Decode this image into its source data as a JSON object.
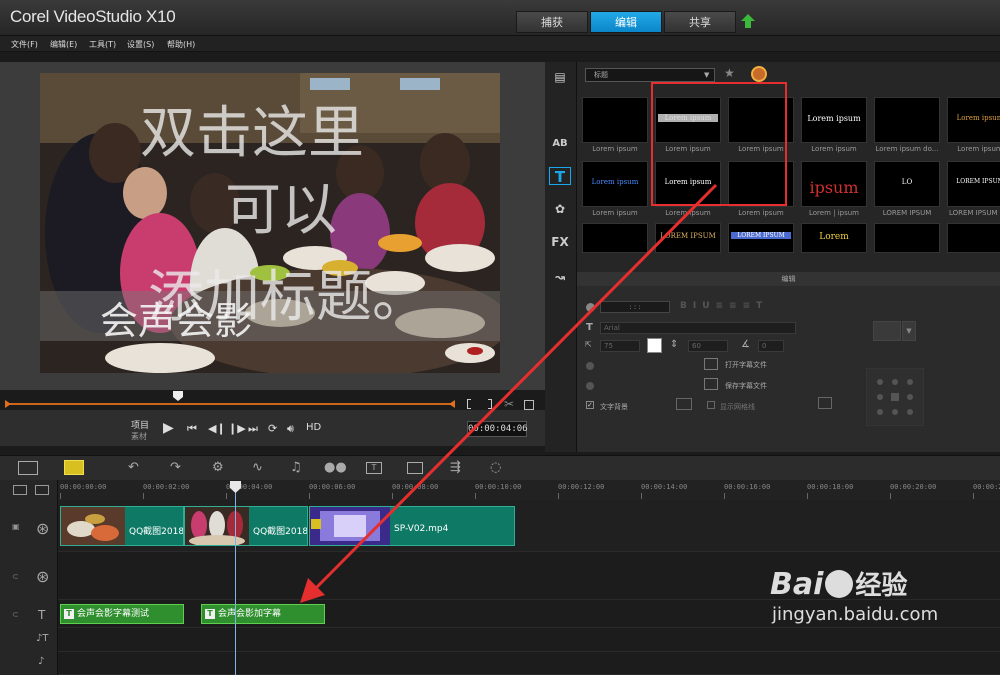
{
  "app": {
    "title": "Corel VideoStudio X10"
  },
  "tabs": [
    {
      "label": "捕获"
    },
    {
      "label": "编辑"
    },
    {
      "label": "共享"
    }
  ],
  "menu": [
    {
      "label": "文件(F)"
    },
    {
      "label": "编辑(E)"
    },
    {
      "label": "工具(T)"
    },
    {
      "label": "设置(S)"
    },
    {
      "label": "帮助(H)"
    }
  ],
  "preview": {
    "overlay_line1": "双击这里",
    "overlay_line2": "可以",
    "overlay_line3": "添加标题。",
    "subtitle_text": "会声会影",
    "project_label": "项目",
    "clip_label": "素材",
    "hd_label": "HD",
    "timecode": "00:00:04:06"
  },
  "library": {
    "dropdown": "标题",
    "thumbnails": [
      {
        "label": "Lorem ipsum",
        "text": ""
      },
      {
        "label": "Lorem ipsum",
        "text": "Lorem ipsum"
      },
      {
        "label": "Lorem ipsum",
        "text": ""
      },
      {
        "label": "Lorem ipsum",
        "text": "Lorem ipsum"
      },
      {
        "label": "Lorem ipsum do...",
        "text": ""
      },
      {
        "label": "Lorem ipsum",
        "text": "Lorem ipsum"
      },
      {
        "label": "Lorem ipsum",
        "text": "Lorem ipsum"
      },
      {
        "label": "Lorem ipsum",
        "text": "Lorem ipsum"
      },
      {
        "label": "Lorem ipsum",
        "text": ""
      },
      {
        "label": "Lorem | ipsum",
        "text": "ipsum"
      },
      {
        "label": "LOREM IPSUM",
        "text": "LO"
      },
      {
        "label": "LOREM IPSUM | ...",
        "text": "LOREM IPSUM"
      },
      {
        "label": "",
        "text": ""
      },
      {
        "label": "",
        "text": "LOREM IPSUM"
      },
      {
        "label": "",
        "text": "LOREM IPSUM"
      },
      {
        "label": "",
        "text": "Lorem"
      },
      {
        "label": "",
        "text": ""
      },
      {
        "label": "",
        "text": ""
      }
    ]
  },
  "props": {
    "header": "编辑",
    "font": "Arial",
    "font_size": "75",
    "line_spacing": "60",
    "angle": "0",
    "open_subtitle": "打开字幕文件",
    "save_subtitle": "保存字幕文件",
    "text_background": "文字背景",
    "show_grid": "显示网格线"
  },
  "ruler": {
    "ticks": [
      "00:00:00:00",
      "00:00:02:00",
      "00:00:04:00",
      "00:00:06:00",
      "00:00:08:00",
      "00:00:10:00",
      "00:00:12:00",
      "00:00:14:00",
      "00:00:16:00",
      "00:00:18:00",
      "00:00:20:00",
      "00:00:22:00"
    ]
  },
  "timeline": {
    "video_clips": [
      {
        "name": "QQ截图2018..."
      },
      {
        "name": "QQ截图2018..."
      },
      {
        "name": "SP-V02.mp4"
      }
    ],
    "title_clips": [
      {
        "name": "会声会影字幕测试"
      },
      {
        "name": "会声会影加字幕"
      }
    ]
  },
  "watermark": {
    "brand": "Bai",
    "brand_cn": "经验",
    "url": "jingyan.baidu.com"
  },
  "colors": {
    "accent": "#0a9be0",
    "clip": "#0e7a66",
    "title_clip": "#2f8f2f",
    "highlight": "#e52e2e"
  }
}
